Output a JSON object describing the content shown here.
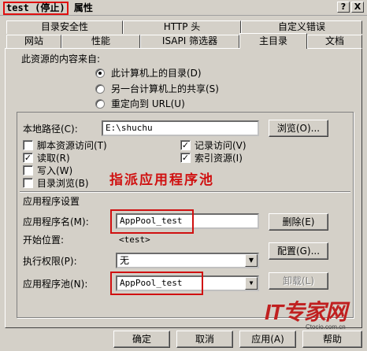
{
  "window": {
    "title_name": "test (停止)",
    "title_suffix": "属性",
    "help_glyph": "?",
    "close_glyph": "X"
  },
  "tabs_back": [
    {
      "label": "目录安全性"
    },
    {
      "label": "HTTP 头"
    },
    {
      "label": "自定义错误"
    }
  ],
  "tabs_front": [
    {
      "label": "网站"
    },
    {
      "label": "性能"
    },
    {
      "label": "ISAPI 筛选器"
    },
    {
      "label": "主目录",
      "active": true
    },
    {
      "label": "文档"
    }
  ],
  "content_source": {
    "heading": "此资源的内容来自:",
    "options": [
      {
        "label": "此计算机上的目录(D)",
        "selected": true
      },
      {
        "label": "另一台计算机上的共享(S)",
        "selected": false
      },
      {
        "label": "重定向到 URL(U)",
        "selected": false
      }
    ]
  },
  "local_path": {
    "label": "本地路径(C):",
    "value": "E:\\shuchu",
    "browse_label": "浏览(O)..."
  },
  "checkboxes": [
    {
      "label": "脚本资源访问(T)",
      "checked": false
    },
    {
      "label": "记录访问(V)",
      "checked": true
    },
    {
      "label": "读取(R)",
      "checked": true
    },
    {
      "label": "索引资源(I)",
      "checked": true
    },
    {
      "label": "写入(W)",
      "checked": false
    },
    {
      "label": "目录浏览(B)",
      "checked": false
    }
  ],
  "annotation": "指派应用程序池",
  "app_settings": {
    "heading": "应用程序设置",
    "app_name_label": "应用程序名(M):",
    "app_name_value": "AppPool_test",
    "remove_label": "删除(E)",
    "start_label": "开始位置:",
    "start_value": "<test>",
    "exec_label": "执行权限(P):",
    "exec_value": "无",
    "config_label": "配置(G)...",
    "pool_label": "应用程序池(N):",
    "pool_value": "AppPool_test",
    "unload_label": "卸载(L)"
  },
  "footer": {
    "ok": "确定",
    "cancel": "取消",
    "apply": "应用(A)",
    "help": "帮助"
  },
  "watermark": {
    "brand": "IT专家网",
    "url": "Ctocio.com.cn"
  },
  "colors": {
    "annotation": "#d01010",
    "dialog_bg": "#d4d0c8"
  }
}
